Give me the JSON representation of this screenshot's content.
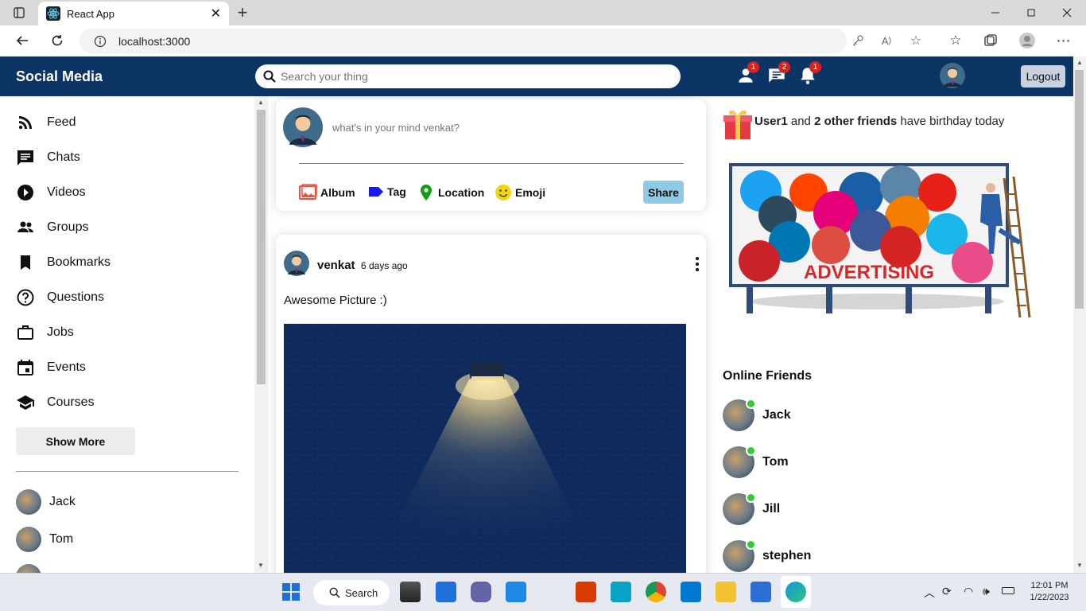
{
  "browser": {
    "tab_title": "React App",
    "url": "localhost:3000"
  },
  "app": {
    "brand": "Social Media",
    "search_placeholder": "Search your thing",
    "badges": {
      "friends": "1",
      "messages": "2",
      "notifications": "1"
    },
    "logout_label": "Logout",
    "colors": {
      "topbar": "#0c3566",
      "online": "#32cd32",
      "badge": "#e0201b",
      "share": "#8ec9e6"
    }
  },
  "sidebar": {
    "items": [
      {
        "label": "Feed",
        "icon": "rss-icon"
      },
      {
        "label": "Chats",
        "icon": "chat-icon"
      },
      {
        "label": "Videos",
        "icon": "play-circle-icon"
      },
      {
        "label": "Groups",
        "icon": "group-icon"
      },
      {
        "label": "Bookmarks",
        "icon": "bookmark-icon"
      },
      {
        "label": "Questions",
        "icon": "help-circle-icon"
      },
      {
        "label": "Jobs",
        "icon": "briefcase-icon"
      },
      {
        "label": "Events",
        "icon": "calendar-icon"
      },
      {
        "label": "Courses",
        "icon": "school-icon"
      }
    ],
    "show_more": "Show More",
    "friends": [
      "Jack",
      "Tom"
    ]
  },
  "share": {
    "placeholder": "what's in your mind venkat?",
    "options": [
      "Album",
      "Tag",
      "Location",
      "Emoji"
    ],
    "button": "Share"
  },
  "post": {
    "username": "venkat",
    "time": "6 days ago",
    "text": "Awesome Picture :)"
  },
  "rightbar": {
    "birthday": {
      "user": "User1",
      "and": "and",
      "others": "2 other friends",
      "rest": "have birthday today"
    },
    "ad_text": "ADVERTISING",
    "online_title": "Online Friends",
    "online": [
      "Jack",
      "Tom",
      "Jill",
      "stephen"
    ]
  },
  "taskbar": {
    "search_label": "Search",
    "time": "12:01 PM",
    "date": "1/22/2023"
  }
}
